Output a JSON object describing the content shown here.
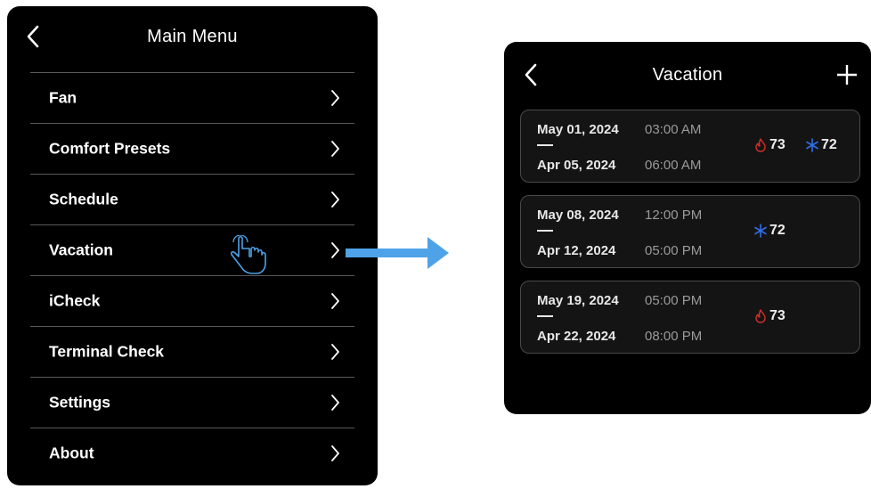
{
  "main_menu": {
    "title": "Main Menu",
    "items": [
      {
        "label": "Fan"
      },
      {
        "label": "Comfort Presets"
      },
      {
        "label": "Schedule"
      },
      {
        "label": "Vacation"
      },
      {
        "label": "iCheck"
      },
      {
        "label": "Terminal Check"
      },
      {
        "label": "Settings"
      },
      {
        "label": "About"
      }
    ]
  },
  "vacation": {
    "title": "Vacation",
    "entries": [
      {
        "start_date": "May 01, 2024",
        "start_time": "03:00 AM",
        "end_date": "Apr 05, 2024",
        "end_time": "06:00 AM",
        "heat": "73",
        "cool": "72"
      },
      {
        "start_date": "May 08, 2024",
        "start_time": "12:00 PM",
        "end_date": "Apr 12, 2024",
        "end_time": "05:00 PM",
        "cool": "72"
      },
      {
        "start_date": "May 19, 2024",
        "start_time": "05:00 PM",
        "end_date": "Apr 22, 2024",
        "end_time": "08:00 PM",
        "heat": "73"
      }
    ]
  },
  "colors": {
    "screen_bg": "#000000",
    "divider": "#5a5a5a",
    "card_border": "#4a4a4a",
    "heat_icon": "#d0312d",
    "cool_icon": "#2f6ee8",
    "arrow": "#4ea3e8"
  },
  "icons": {
    "back": "chevron-left-icon",
    "add": "plus-icon",
    "row_chevron": "chevron-right-icon",
    "pointer": "hand-pointer-icon",
    "heat": "flame-icon",
    "cool": "snowflake-icon",
    "transition": "arrow-right-icon"
  }
}
